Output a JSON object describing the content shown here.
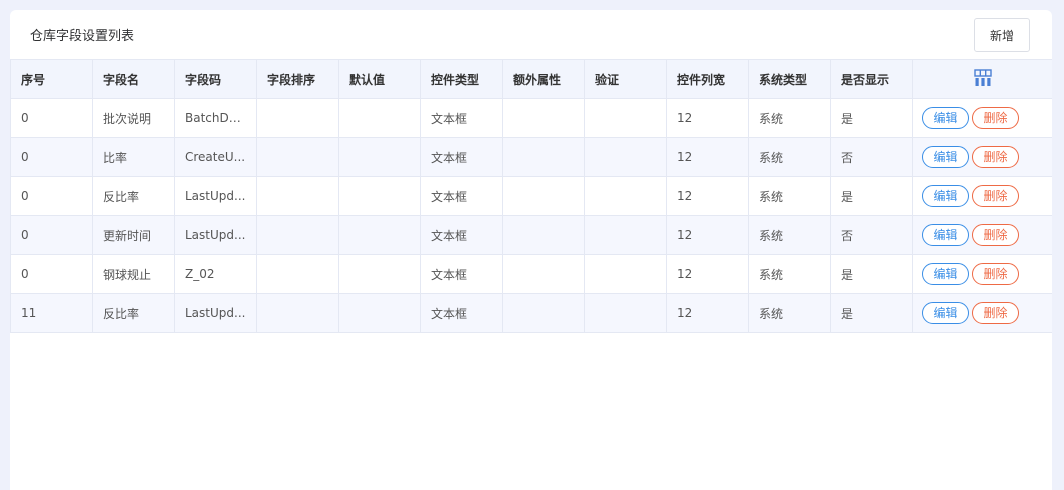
{
  "page": {
    "title": "仓库字段设置列表",
    "add_label": "新增"
  },
  "table": {
    "columns": [
      "序号",
      "字段名",
      "字段码",
      "字段排序",
      "默认值",
      "控件类型",
      "额外属性",
      "验证",
      "控件列宽",
      "系统类型",
      "是否显示"
    ],
    "settings_icon": "grid-settings-icon",
    "edit_label": "编辑",
    "delete_label": "删除",
    "rows": [
      {
        "seq": "0",
        "name": "批次说明",
        "code": "BatchDesc",
        "sort": "",
        "default": "",
        "control": "文本框",
        "extra": "",
        "validate": "",
        "width": "12",
        "systype": "系统",
        "visible": "是"
      },
      {
        "seq": "0",
        "name": "比率",
        "code": "CreateU...",
        "sort": "",
        "default": "",
        "control": "文本框",
        "extra": "",
        "validate": "",
        "width": "12",
        "systype": "系统",
        "visible": "否"
      },
      {
        "seq": "0",
        "name": "反比率",
        "code": "LastUpd...",
        "sort": "",
        "default": "",
        "control": "文本框",
        "extra": "",
        "validate": "",
        "width": "12",
        "systype": "系统",
        "visible": "是"
      },
      {
        "seq": "0",
        "name": "更新时间",
        "code": "LastUpd...",
        "sort": "",
        "default": "",
        "control": "文本框",
        "extra": "",
        "validate": "",
        "width": "12",
        "systype": "系统",
        "visible": "否"
      },
      {
        "seq": "0",
        "name": "钢球规止",
        "code": "Z_02",
        "sort": "",
        "default": "",
        "control": "文本框",
        "extra": "",
        "validate": "",
        "width": "12",
        "systype": "系统",
        "visible": "是"
      },
      {
        "seq": "11",
        "name": "反比率",
        "code": "LastUpd...",
        "sort": "",
        "default": "",
        "control": "文本框",
        "extra": "",
        "validate": "",
        "width": "12",
        "systype": "系统",
        "visible": "是"
      }
    ]
  },
  "colors": {
    "accent": "#3a8ee6",
    "danger": "#ee6a45",
    "header_bg": "#f2f5fd"
  }
}
